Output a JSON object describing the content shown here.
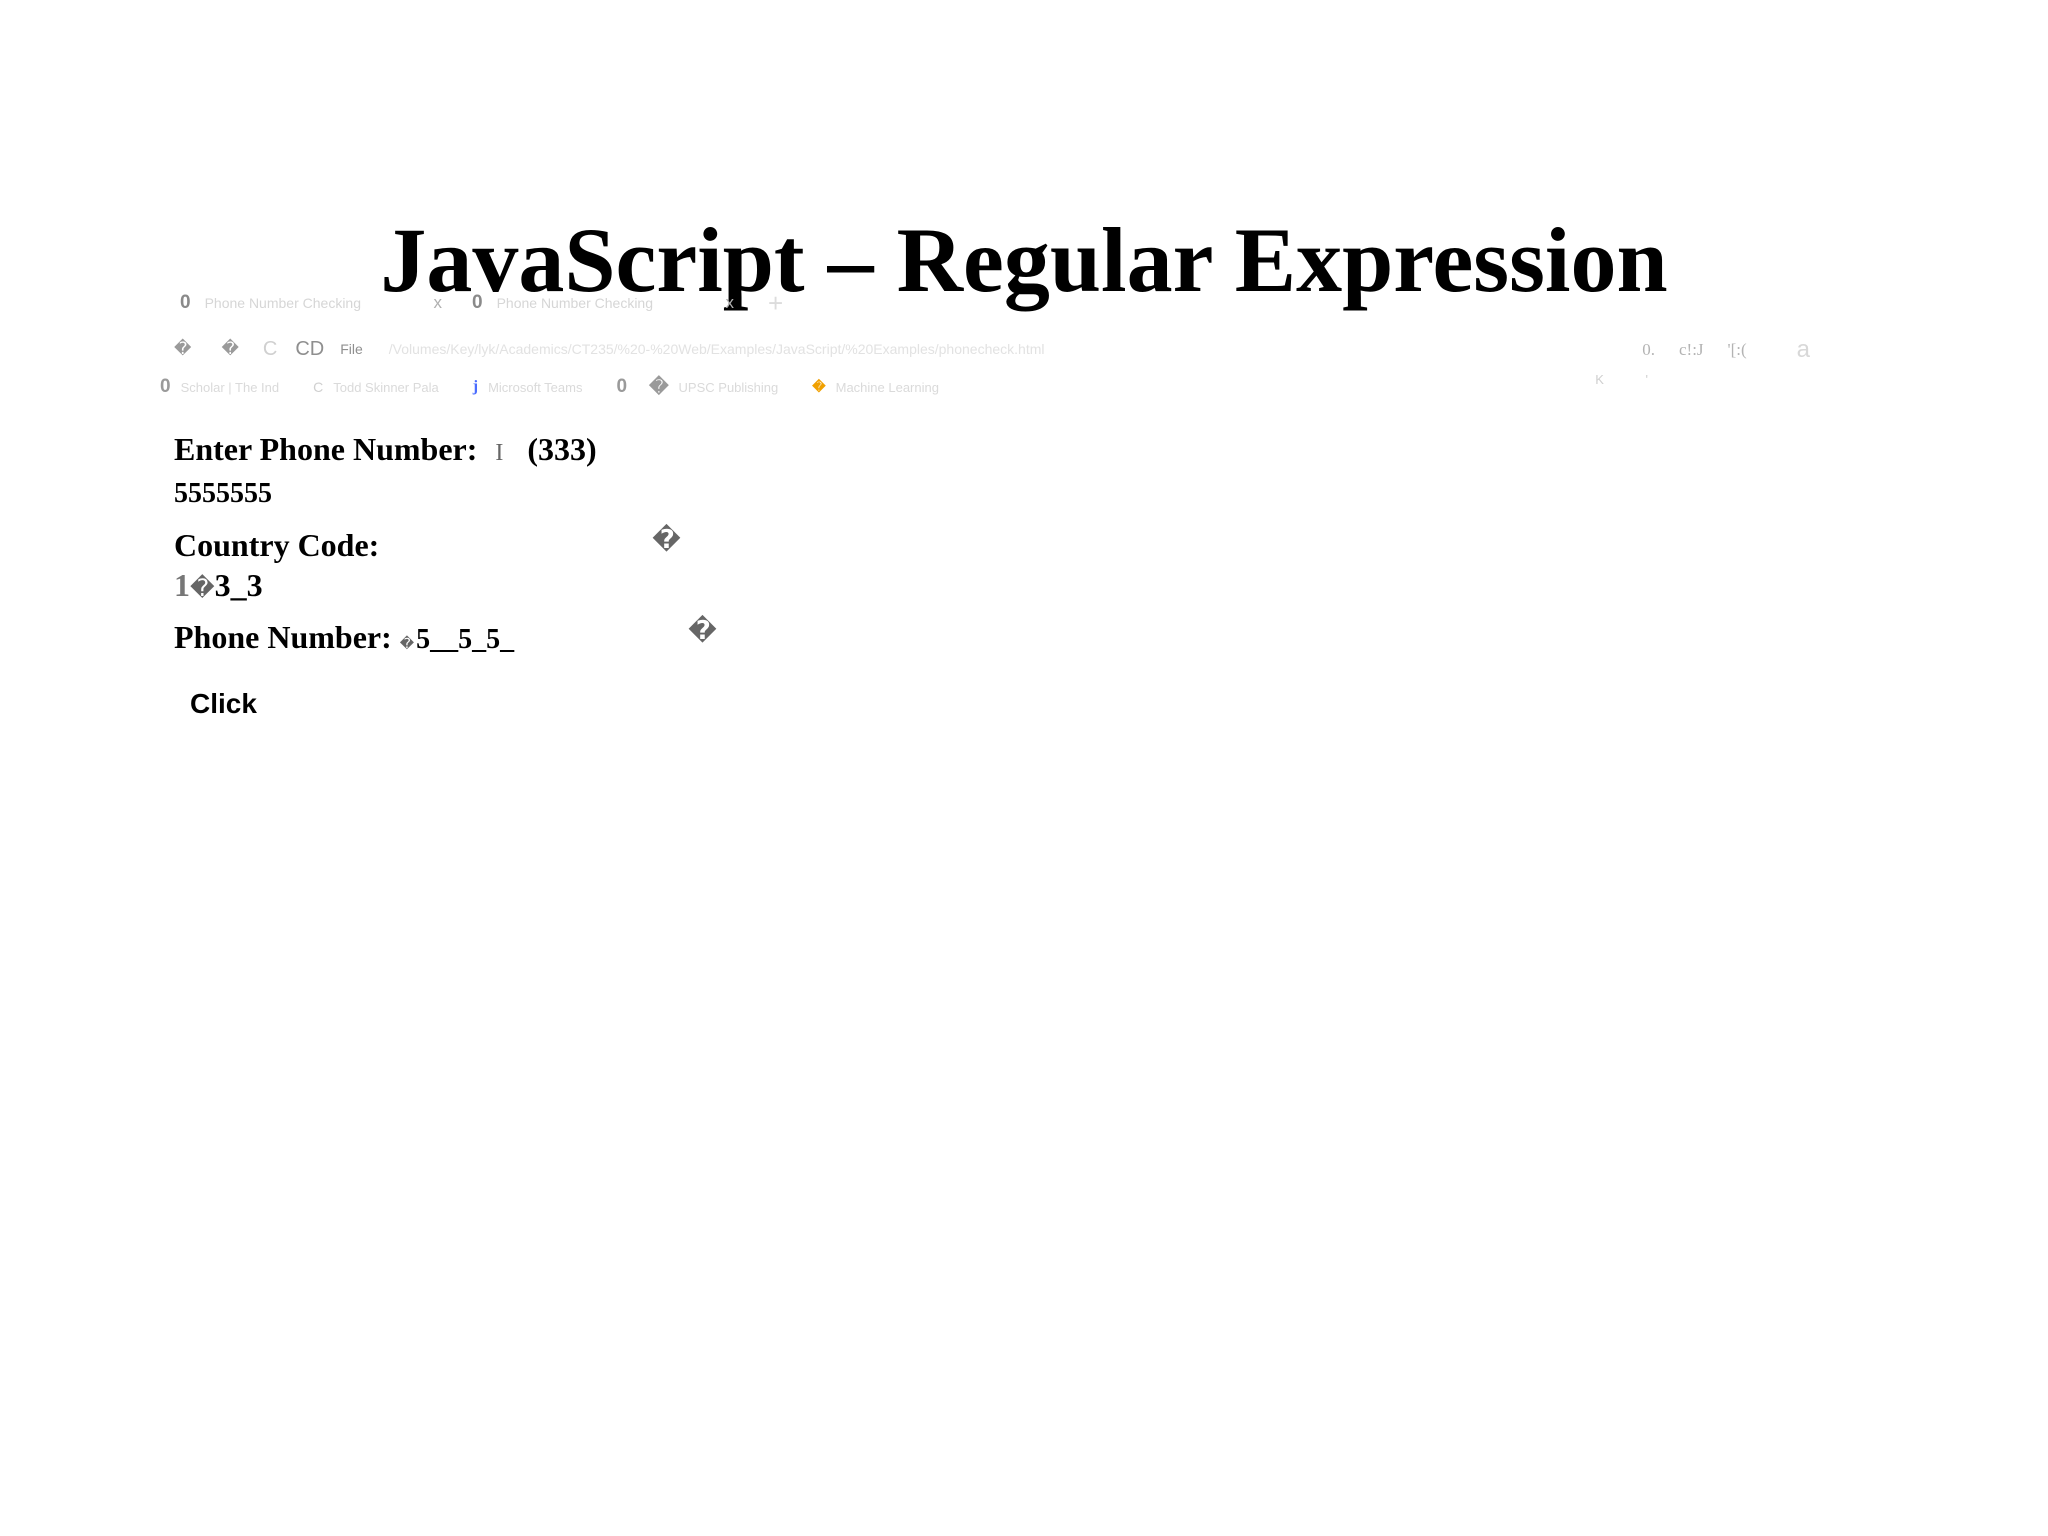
{
  "title": "JavaScript – Regular Expression",
  "browser": {
    "tabs": [
      {
        "favicon": "0",
        "label": "Phone Number Checking",
        "close": "x"
      },
      {
        "favicon": "0",
        "label": "Phone Number Checking",
        "close": "x"
      }
    ],
    "new_tab": "+",
    "back": "�",
    "forward": "�",
    "reload": "C",
    "page_info": "CD",
    "scheme": "File",
    "url": "/Volumes/Key/lyk/Academics/CT235/%20-%20Web/Examples/JavaScript/%20Examples/phonecheck.html",
    "right_icons": [
      "0.",
      "c!:J",
      "'[:(",
      "a"
    ],
    "right_sub": [
      "K",
      "'"
    ],
    "bookmarks": [
      {
        "icon": "0",
        "label": "Scholar | The Ind"
      },
      {
        "icon": "C",
        "label": "Todd Skinner Pala"
      },
      {
        "icon": "j",
        "label": "Microsoft Teams"
      },
      {
        "icon": "0",
        "label": ""
      },
      {
        "icon": "�",
        "label": "UPSC Publishing"
      },
      {
        "icon": "�",
        "label": "Machine Learning"
      }
    ]
  },
  "form": {
    "enter_label": "Enter Phone Number:",
    "cursor": "I",
    "enter_value_1": "(333)",
    "enter_value_2": "5555555",
    "country_label": "Country Code:",
    "country_glyph": "�",
    "country_value_a": "1",
    "country_value_glyph": "�",
    "country_value_b": "3_3",
    "phone_label": "Phone Number:",
    "phone_value_glyph": "�",
    "phone_value": "5__5_5_",
    "phone_glyph": "�"
  },
  "button": {
    "label": "Click"
  }
}
